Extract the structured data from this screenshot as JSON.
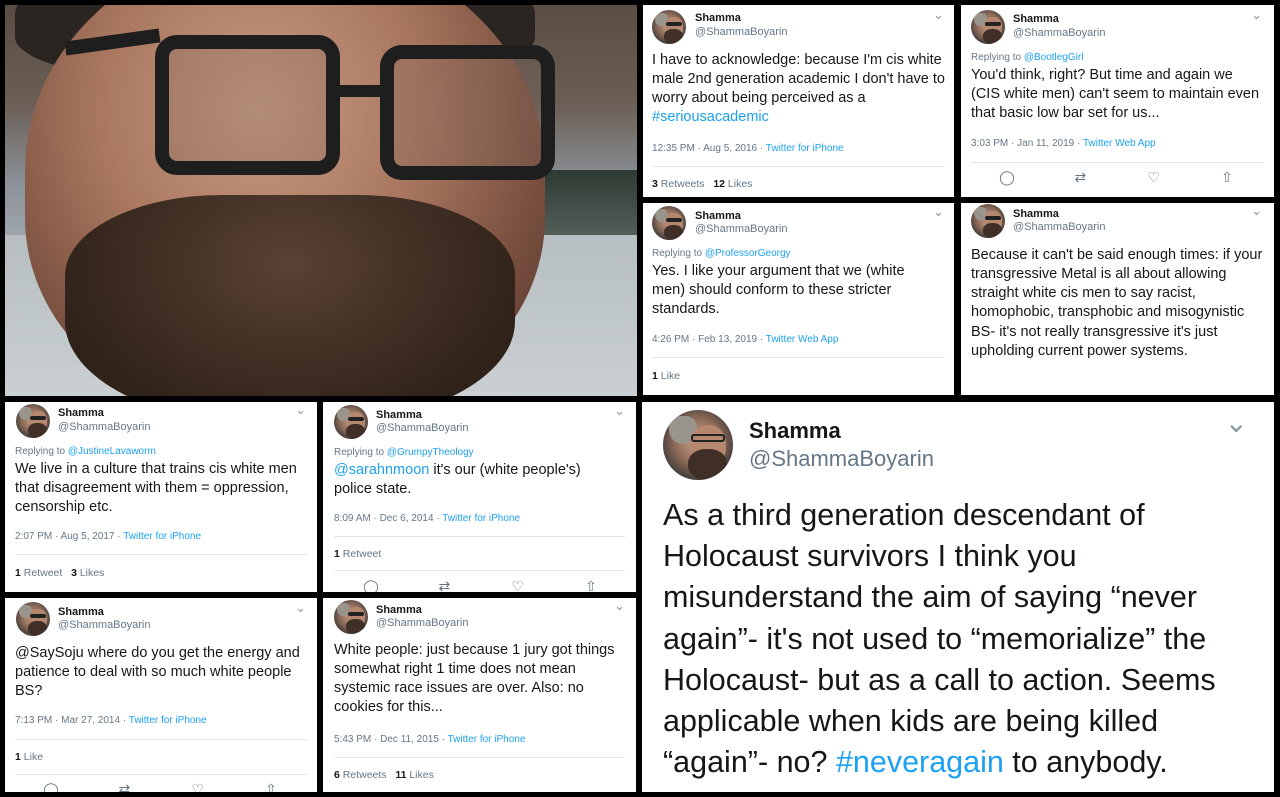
{
  "tweets": [
    {
      "name": "Shamma",
      "handle": "@ShammaBoyarin",
      "text_plain": "I have to acknowledge: because I'm cis white male 2nd generation academic I don't have to worry about being perceived as a ",
      "hashtag": "#seriousacademic",
      "time": "12:35 PM · Aug 5, 2016 ·",
      "app": "Twitter for iPhone",
      "retweets_count": "3",
      "retweets_label": "Retweets",
      "likes_count": "12",
      "likes_label": "Likes"
    },
    {
      "name": "Shamma",
      "handle": "@ShammaBoyarin",
      "reply_label": "Replying to",
      "reply_to": "@BootlegGirl",
      "text_plain": "You'd think, right? But time and again we (CIS white men) can't seem to maintain even that basic low bar set for us...",
      "time": "3:03 PM · Jan 11, 2019 ·",
      "app": "Twitter Web App"
    },
    {
      "name": "Shamma",
      "handle": "@ShammaBoyarin",
      "reply_label": "Replying to",
      "reply_to": "@ProfessorGeorgy",
      "text_plain": "Yes. I like your argument that we (white men) should conform to these stricter standards.",
      "time": "4:26 PM · Feb 13, 2019 ·",
      "app": "Twitter Web App",
      "likes_count": "1",
      "likes_label": "Like"
    },
    {
      "name": "Shamma",
      "handle": "@ShammaBoyarin",
      "text_plain": "Because it can't be said enough times: if your transgressive Metal is all about allowing straight white cis men to say racist, homophobic, transphobic and misogynistic BS- it's not really transgressive it's just upholding current power systems."
    },
    {
      "name": "Shamma",
      "handle": "@ShammaBoyarin",
      "reply_label": "Replying to",
      "reply_to": "@JustineLavaworm",
      "text_plain": "We live in a culture that trains cis white men that disagreement with them = oppression, censorship etc.",
      "time": "2:07 PM · Aug 5, 2017 ·",
      "app": "Twitter for iPhone",
      "retweets_count": "1",
      "retweets_label": "Retweet",
      "likes_count": "3",
      "likes_label": "Likes"
    },
    {
      "name": "Shamma",
      "handle": "@ShammaBoyarin",
      "reply_label": "Replying to",
      "reply_to": "@GrumpyTheology",
      "mention": "@sarahnmoon",
      "text_plain": " it's our (white people's) police state.",
      "time": "8:09 AM · Dec 6, 2014 ·",
      "app": "Twitter for iPhone",
      "retweets_count": "1",
      "retweets_label": "Retweet"
    },
    {
      "name": "Shamma",
      "handle": "@ShammaBoyarin",
      "text_plain": "@SaySoju where do you get the energy and patience to deal with so much white people BS?",
      "time": "7:13 PM · Mar 27, 2014 ·",
      "app": "Twitter for iPhone",
      "likes_count": "1",
      "likes_label": "Like"
    },
    {
      "name": "Shamma",
      "handle": "@ShammaBoyarin",
      "text_plain": "White people: just because 1 jury got things somewhat right 1 time does not mean systemic race issues are over. Also: no cookies for this...",
      "time": "5:43 PM · Dec 11, 2015 ·",
      "app": "Twitter for iPhone",
      "retweets_count": "6",
      "retweets_label": "Retweets",
      "likes_count": "11",
      "likes_label": "Likes"
    },
    {
      "name": "Shamma",
      "handle": "@ShammaBoyarin",
      "text_plain": "As a third generation descendant of Holocaust survivors I think you misunderstand the aim of saying “never again”- it's not used to “memorialize” the Holocaust- but as a call to action. Seems applicable when kids are being killed “again”- no? ",
      "hashtag": "#neveragain",
      "text_tail": " to anybody."
    }
  ],
  "icons": {
    "chevron": "⌄",
    "reply": "◯",
    "retweet": "⇄",
    "like": "♡",
    "share": "⇧"
  },
  "colors": {
    "link": "#1da1f2",
    "muted": "#657786",
    "text": "#14171a",
    "background": "#000000"
  }
}
